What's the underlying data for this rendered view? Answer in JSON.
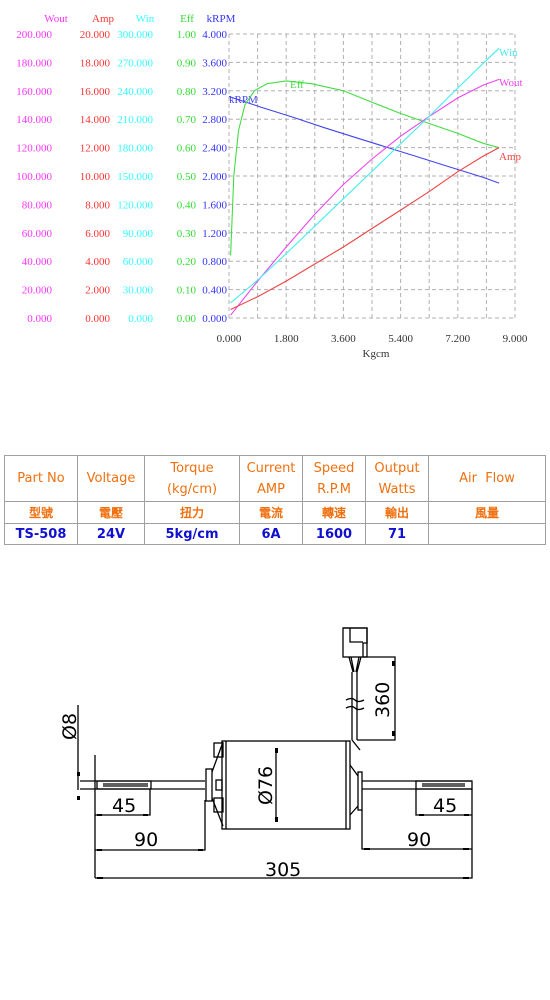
{
  "chart_data": {
    "type": "line",
    "title": "",
    "xlabel": "Kgcm",
    "x_ticks": [
      "0.000",
      "1.800",
      "3.600",
      "5.400",
      "7.200",
      "9.000"
    ],
    "xlim": [
      0,
      9
    ],
    "grid": true,
    "axes": [
      {
        "name": "Wout",
        "color": "#ff33ff",
        "ticks": [
          "0.000",
          "20.000",
          "40.000",
          "60.000",
          "80.000",
          "100.000",
          "120.000",
          "140.000",
          "160.000",
          "180.000",
          "200.000"
        ],
        "range": [
          0,
          200
        ]
      },
      {
        "name": "Amp",
        "color": "#ff3333",
        "ticks": [
          "0.000",
          "2.000",
          "4.000",
          "6.000",
          "8.000",
          "10.000",
          "12.000",
          "14.000",
          "16.000",
          "18.000",
          "20.000"
        ],
        "range": [
          0,
          20
        ]
      },
      {
        "name": "Win",
        "color": "#33ffff",
        "ticks": [
          "0.000",
          "30.000",
          "60.000",
          "90.000",
          "120.000",
          "150.000",
          "180.000",
          "210.000",
          "240.000",
          "270.000",
          "300.000"
        ],
        "range": [
          0,
          300
        ]
      },
      {
        "name": "Eff",
        "color": "#33dd33",
        "ticks": [
          "0.00",
          "0.10",
          "0.20",
          "0.30",
          "0.40",
          "0.50",
          "0.60",
          "0.70",
          "0.80",
          "0.90",
          "1.00"
        ],
        "range": [
          0,
          1
        ]
      },
      {
        "name": "kRPM",
        "color": "#3333ff",
        "ticks": [
          "0.000",
          "0.400",
          "0.800",
          "1.200",
          "1.600",
          "2.000",
          "2.400",
          "2.800",
          "3.200",
          "3.600",
          "4.000"
        ],
        "range": [
          0,
          4
        ]
      }
    ],
    "series": [
      {
        "name": "kRPM",
        "label": "kRPM",
        "color": "#4444ee",
        "x": [
          0.0,
          1.0,
          2.0,
          3.0,
          4.0,
          5.0,
          6.0,
          7.0,
          8.0,
          8.5
        ],
        "values": [
          3.12,
          2.97,
          2.83,
          2.68,
          2.54,
          2.4,
          2.26,
          2.12,
          1.98,
          1.9
        ]
      },
      {
        "name": "Eff",
        "label": "Eff",
        "color": "#44dd44",
        "x": [
          0.05,
          0.15,
          0.3,
          0.5,
          0.8,
          1.2,
          1.8,
          2.6,
          3.6,
          4.5,
          5.4,
          6.3,
          7.2,
          8.0,
          8.5
        ],
        "values": [
          0.22,
          0.5,
          0.66,
          0.75,
          0.8,
          0.825,
          0.835,
          0.825,
          0.8,
          0.76,
          0.72,
          0.685,
          0.65,
          0.615,
          0.6
        ]
      },
      {
        "name": "Wout",
        "label": "Wout",
        "color": "#ee44ee",
        "x": [
          0.05,
          0.9,
          1.8,
          2.7,
          3.6,
          4.5,
          5.4,
          6.3,
          7.2,
          8.0,
          8.5
        ],
        "values": [
          2,
          26,
          50,
          73,
          94,
          112,
          128,
          142,
          155,
          164,
          168
        ]
      },
      {
        "name": "Win",
        "label": "Win",
        "color": "#44eeee",
        "x": [
          0.05,
          0.9,
          1.8,
          2.7,
          3.6,
          4.5,
          5.4,
          6.3,
          7.2,
          8.0,
          8.5
        ],
        "values": [
          16,
          40,
          68,
          97,
          126,
          155,
          184,
          213,
          243,
          269,
          285
        ]
      },
      {
        "name": "Amp",
        "label": "Amp",
        "color": "#ee4444",
        "x": [
          0.05,
          0.9,
          1.8,
          2.7,
          3.6,
          4.5,
          5.4,
          6.3,
          7.2,
          8.0,
          8.5
        ],
        "values": [
          0.6,
          1.5,
          2.6,
          3.8,
          5.0,
          6.3,
          7.6,
          8.9,
          10.3,
          11.4,
          12.0
        ]
      }
    ]
  },
  "spec_table": {
    "headers": [
      {
        "line1": "Part No",
        "line2": ""
      },
      {
        "line1": "Voltage",
        "line2": ""
      },
      {
        "line1": "Torque",
        "line2": "(kg/cm)"
      },
      {
        "line1": "Current",
        "line2": "AMP"
      },
      {
        "line1": "Speed",
        "line2": "R.P.M"
      },
      {
        "line1": "Output",
        "line2": "Watts"
      },
      {
        "line1": "Air  Flow",
        "line2": ""
      }
    ],
    "chinese_headers": [
      "型號",
      "電壓",
      "扭力",
      "電流",
      "轉速",
      "輸出",
      "風量"
    ],
    "row": [
      "TS-508",
      "24V",
      "5kg/cm",
      "6A",
      "1600",
      "71",
      ""
    ]
  },
  "drawing": {
    "dim_shaft_diameter": "Ø8",
    "dim_body_diameter": "Ø76",
    "dim_cable_length": "360",
    "dim_left_shaft_flat": "45",
    "dim_right_shaft_flat": "45",
    "dim_left_shaft": "90",
    "dim_right_shaft": "90",
    "dim_total_length": "305"
  }
}
